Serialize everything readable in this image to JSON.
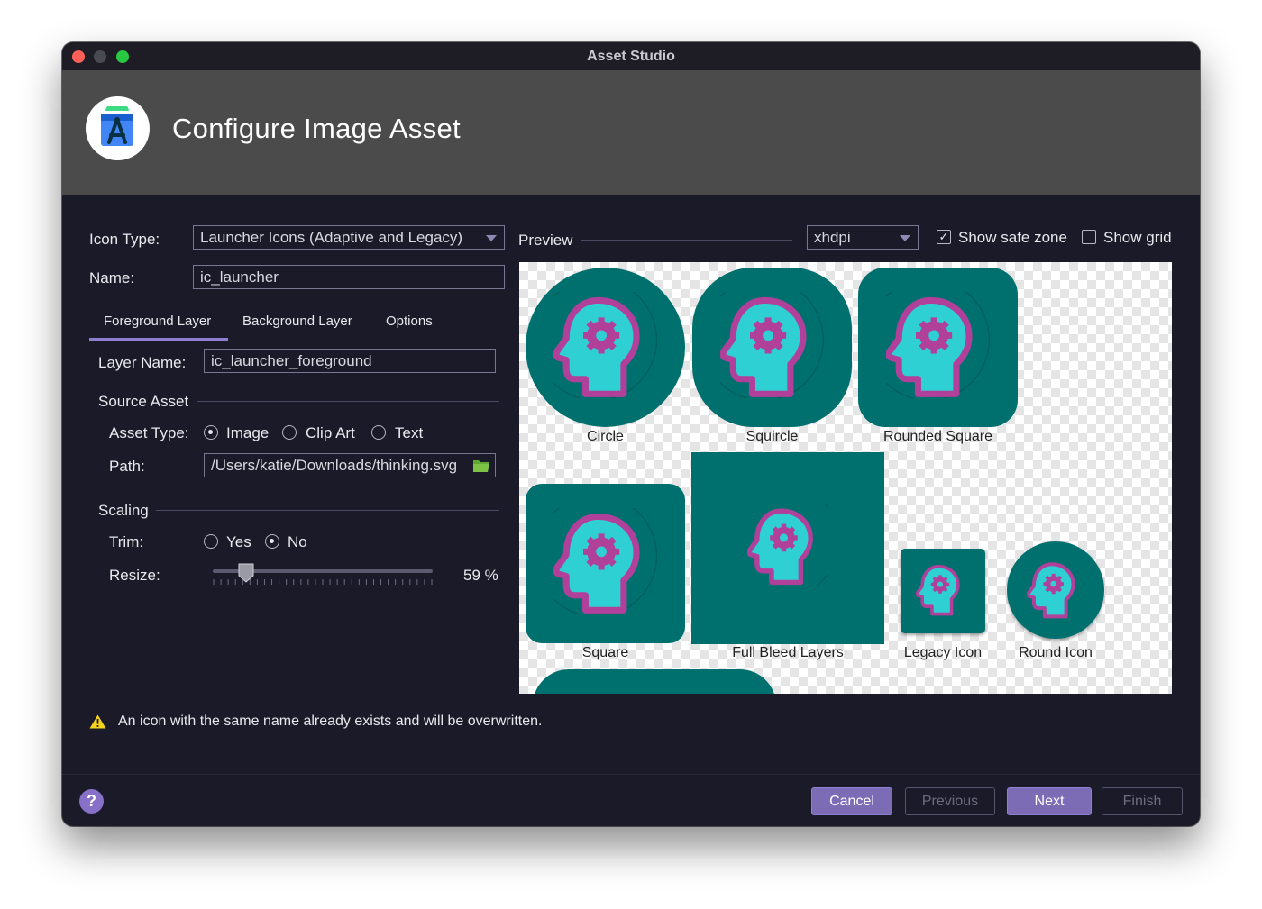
{
  "window": {
    "title": "Asset Studio"
  },
  "header": {
    "title": "Configure Image Asset"
  },
  "form": {
    "icon_type_label": "Icon Type:",
    "icon_type_value": "Launcher Icons (Adaptive and Legacy)",
    "name_label": "Name:",
    "name_value": "ic_launcher"
  },
  "tabs": [
    {
      "label": "Foreground Layer",
      "selected": true
    },
    {
      "label": "Background Layer"
    },
    {
      "label": "Options"
    }
  ],
  "layer": {
    "name_label": "Layer Name:",
    "name_value": "ic_launcher_foreground"
  },
  "source_asset": {
    "section": "Source Asset",
    "asset_type_label": "Asset Type:",
    "options": [
      "Image",
      "Clip Art",
      "Text"
    ],
    "selected": "Image",
    "path_label": "Path:",
    "path_value": "/Users/katie/Downloads/thinking.svg"
  },
  "scaling": {
    "section": "Scaling",
    "trim_label": "Trim:",
    "trim_options": [
      "Yes",
      "No"
    ],
    "trim_selected": "No",
    "resize_label": "Resize:",
    "resize_value": 59,
    "resize_text": "59 %"
  },
  "preview": {
    "label": "Preview",
    "density": "xhdpi",
    "show_safe_zone_label": "Show safe zone",
    "show_safe_zone": true,
    "show_grid_label": "Show grid",
    "show_grid": false,
    "icons": [
      "Circle",
      "Squircle",
      "Rounded Square",
      "Square",
      "Full Bleed Layers",
      "Legacy Icon",
      "Round Icon"
    ]
  },
  "warning": {
    "icon": "warning-icon",
    "text": "An icon with the same name already exists and will be overwritten."
  },
  "footer": {
    "help": "?",
    "cancel": "Cancel",
    "previous": "Previous",
    "next": "Next",
    "finish": "Finish"
  },
  "colors": {
    "accent": "#7c6bb5",
    "icon_background": "#00706f",
    "head": "#2fd0d3",
    "head_outline": "#b0409a",
    "warning": "#f5d31d"
  }
}
